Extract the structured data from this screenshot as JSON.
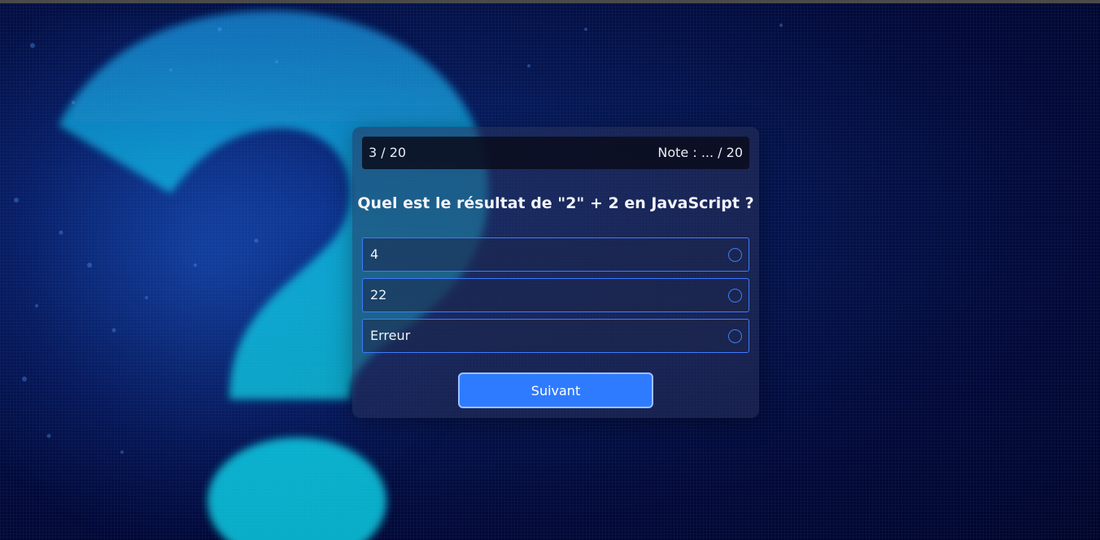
{
  "quiz": {
    "progress": "3 / 20",
    "score": "Note : ... / 20",
    "question": "Quel est le résultat de \"2\" + 2 en JavaScript ?",
    "options": [
      {
        "label": "4",
        "selected": false
      },
      {
        "label": "22",
        "selected": false
      },
      {
        "label": "Erreur",
        "selected": false
      }
    ],
    "next_label": "Suivant"
  },
  "colors": {
    "accent": "#2f7bff",
    "option_border": "#3d7bff",
    "background": "#030a38"
  },
  "icons": {
    "background_decoration": "question-mark-icon",
    "option_radio": "radio-unselected-icon"
  }
}
